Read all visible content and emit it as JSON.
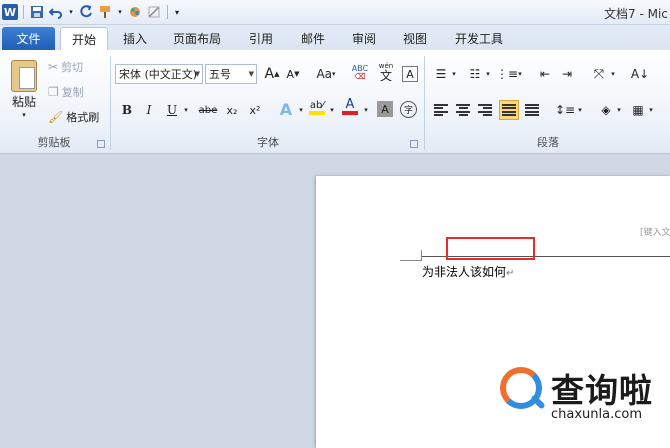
{
  "window": {
    "title": "文档7 - Mic"
  },
  "tabs": {
    "file": "文件",
    "home": "开始",
    "insert": "插入",
    "page_layout": "页面布局",
    "references": "引用",
    "mailings": "邮件",
    "review": "审阅",
    "view": "视图",
    "developer": "开发工具"
  },
  "clipboard": {
    "paste": "粘贴",
    "cut": "剪切",
    "copy": "复制",
    "format_painter": "格式刷",
    "label": "剪贴板"
  },
  "font": {
    "name": "宋体 (中文正文)",
    "size": "五号",
    "grow": "A",
    "shrink": "A",
    "change_case": "Aa",
    "wen": "wén",
    "wen_char": "文",
    "clear_format": "A",
    "bold": "B",
    "italic": "I",
    "underline": "U",
    "strike": "abe",
    "subscript": "x₂",
    "superscript": "x²",
    "text_effect": "A",
    "highlight": "ab⁄",
    "font_color": "A",
    "shading": "A",
    "enclose": "字",
    "label": "字体"
  },
  "paragraph": {
    "label": "段落"
  },
  "document": {
    "header_hint": "[键入文",
    "text": "为非法人该如何",
    "para_mark": "↵"
  },
  "watermark": {
    "title": "查询啦",
    "subtitle": "chaxunla.com"
  },
  "colors": {
    "file_tab": "#2a6bc7",
    "highlight_box": "#e0302e",
    "font_color_bar": "#e02020",
    "highlight_bar": "#ffe000"
  }
}
